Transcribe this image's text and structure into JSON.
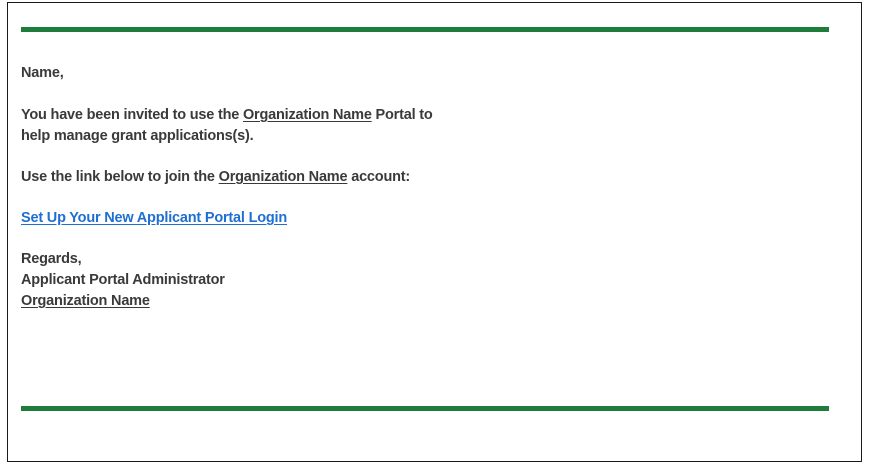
{
  "theme": {
    "accent": "#1e7d3a",
    "link_color": "#1f6fd1",
    "text_color": "#3a3a3a"
  },
  "email": {
    "greeting": "Name,",
    "invite": {
      "prefix": "You have been invited to use the ",
      "org": "Organization Name",
      "suffix_line1": " Portal to",
      "line2": "help manage grant applications(s)."
    },
    "instruction": {
      "prefix": "Use the link below to join the ",
      "org": "Organization Name",
      "suffix": " account:"
    },
    "link_label": "Set Up Your New Applicant Portal Login",
    "signature": {
      "closing": "Regards,",
      "title": "Applicant Portal Administrator",
      "org": "Organization Name"
    }
  }
}
